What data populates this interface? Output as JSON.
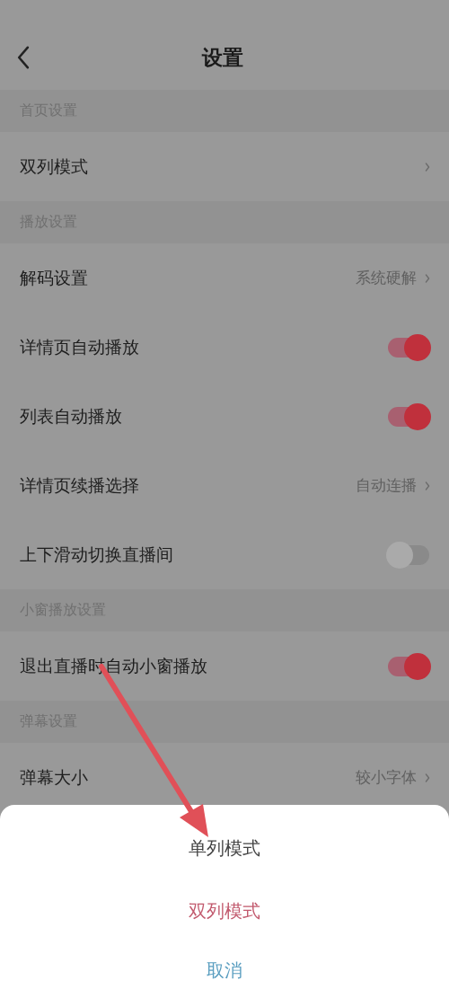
{
  "header": {
    "title": "设置"
  },
  "sections": [
    {
      "title": "首页设置",
      "rows": [
        {
          "kind": "nav",
          "label": "双列模式"
        }
      ]
    },
    {
      "title": "播放设置",
      "rows": [
        {
          "kind": "nav",
          "label": "解码设置",
          "value": "系统硬解"
        },
        {
          "kind": "toggle",
          "label": "详情页自动播放",
          "on": true
        },
        {
          "kind": "toggle",
          "label": "列表自动播放",
          "on": true
        },
        {
          "kind": "nav",
          "label": "详情页续播选择",
          "value": "自动连播"
        },
        {
          "kind": "toggle",
          "label": "上下滑动切换直播间",
          "on": false
        }
      ]
    },
    {
      "title": "小窗播放设置",
      "rows": [
        {
          "kind": "toggle",
          "label": "退出直播时自动小窗播放",
          "on": true
        }
      ]
    },
    {
      "title": "弹幕设置",
      "rows": [
        {
          "kind": "nav",
          "label": "弹幕大小",
          "value": "较小字体"
        }
      ]
    }
  ],
  "sheet": {
    "options": [
      {
        "label": "单列模式",
        "selected": false
      },
      {
        "label": "双列模式",
        "selected": true
      }
    ],
    "cancel": "取消"
  }
}
